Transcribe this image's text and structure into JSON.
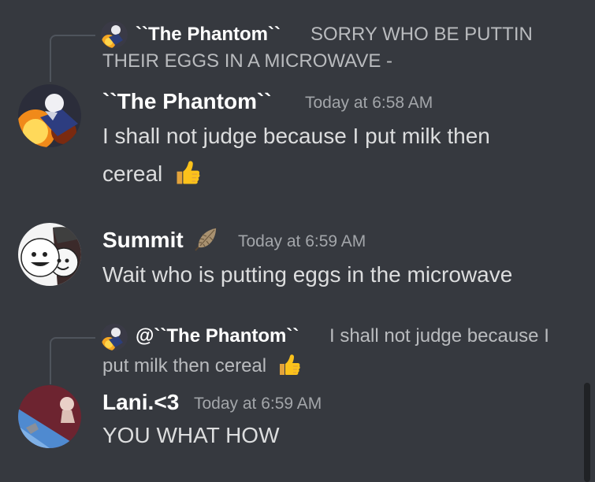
{
  "messages": [
    {
      "reply": {
        "author": "``The Phantom``",
        "text_line1": "SORRY WHO BE PUTTIN",
        "text_line2": "THEIR EGGS IN A MICROWAVE -"
      },
      "author": "``The Phantom``",
      "timestamp": "Today at 6:58 AM",
      "text_line1": "I shall not judge because I put milk then",
      "text_line2": "cereal",
      "emoji": "thumbs-up"
    },
    {
      "author": "Summit",
      "author_badge": "feather",
      "timestamp": "Today at 6:59 AM",
      "text": "Wait who is putting eggs in the microwave"
    },
    {
      "reply": {
        "author": "@``The Phantom``",
        "text_line1": "I shall not judge because I",
        "text_line2": "put milk then cereal",
        "emoji": "thumbs-up"
      },
      "author": "Lani.<3",
      "timestamp": "Today at 6:59 AM",
      "text": "YOU WHAT HOW"
    }
  ],
  "colors": {
    "background": "#36393f",
    "username": "#ffffff",
    "message_text": "#dcddde",
    "timestamp": "#a3a6aa",
    "reply_text": "#b9bbbe"
  }
}
